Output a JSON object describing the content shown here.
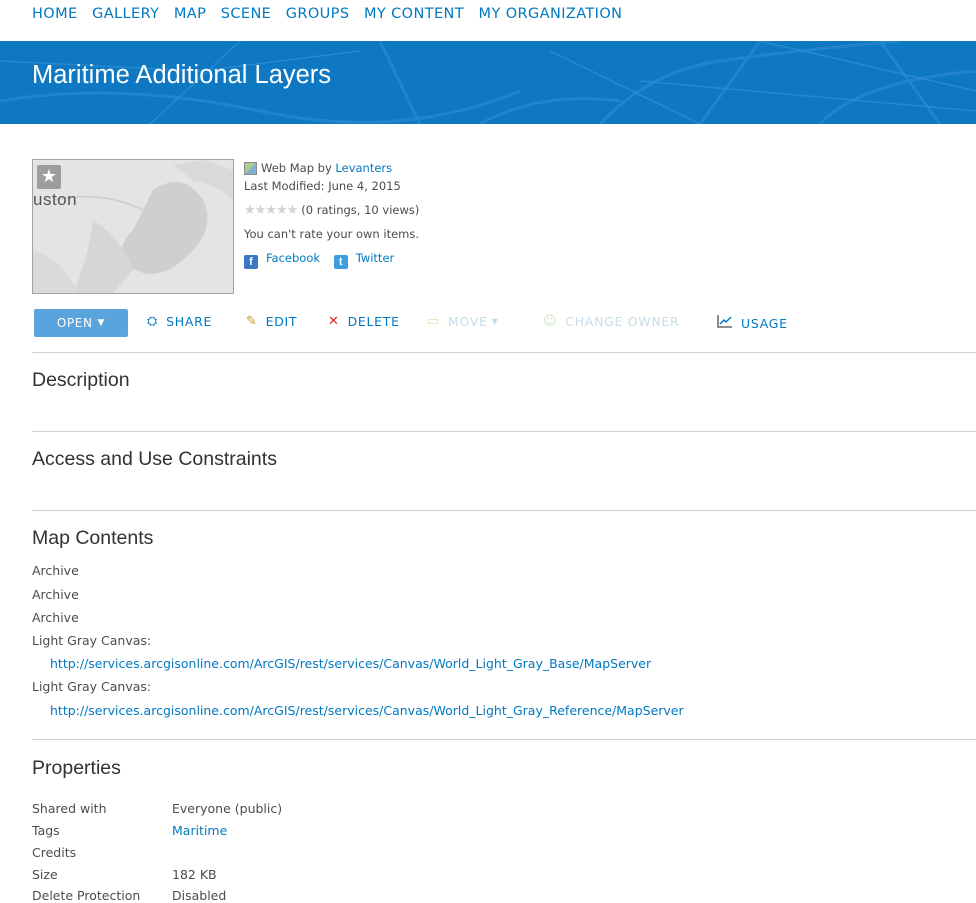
{
  "nav": [
    "HOME",
    "GALLERY",
    "MAP",
    "SCENE",
    "GROUPS",
    "MY CONTENT",
    "MY ORGANIZATION"
  ],
  "title": "Maritime Additional Layers",
  "thumbnail": {
    "label": "uston",
    "favorite_icon": "star-icon"
  },
  "item": {
    "type": "Web Map",
    "by": "by",
    "owner": "Levanters",
    "last_modified": "Last Modified: June 4, 2015",
    "rating_stars": "★★★★★",
    "ratings": "(0 ratings, 10 views)",
    "rate_note": "You can't rate your own items.",
    "facebook": "Facebook",
    "twitter": "Twitter"
  },
  "actions": {
    "open": "OPEN",
    "share": "SHARE",
    "edit": "EDIT",
    "delete": "DELETE",
    "move": "MOVE",
    "change_owner": "CHANGE OWNER",
    "usage": "USAGE"
  },
  "sections": {
    "description": "Description",
    "constraints": "Access and Use Constraints",
    "map_contents": "Map Contents",
    "properties": "Properties"
  },
  "map_contents": {
    "archive_1": "Archive",
    "archive_2": "Archive",
    "archive_3": "Archive",
    "canvas_base_label": "Light Gray Canvas:",
    "canvas_base_url": "http://services.arcgisonline.com/ArcGIS/rest/services/Canvas/World_Light_Gray_Base/MapServer",
    "canvas_ref_label": "Light Gray Canvas:",
    "canvas_ref_url": "http://services.arcgisonline.com/ArcGIS/rest/services/Canvas/World_Light_Gray_Reference/MapServer"
  },
  "properties": {
    "shared_label": "Shared with",
    "shared_value": "Everyone (public)",
    "tags_label": "Tags",
    "tags_value": "Maritime",
    "credits_label": "Credits",
    "size_label": "Size",
    "size_value": "182 KB",
    "delete_label": "Delete Protection",
    "delete_value": "Disabled"
  },
  "colors": {
    "brand_blue": "#0079c1",
    "banner": "#0f78c3",
    "open_button": "#5aa4dd"
  }
}
